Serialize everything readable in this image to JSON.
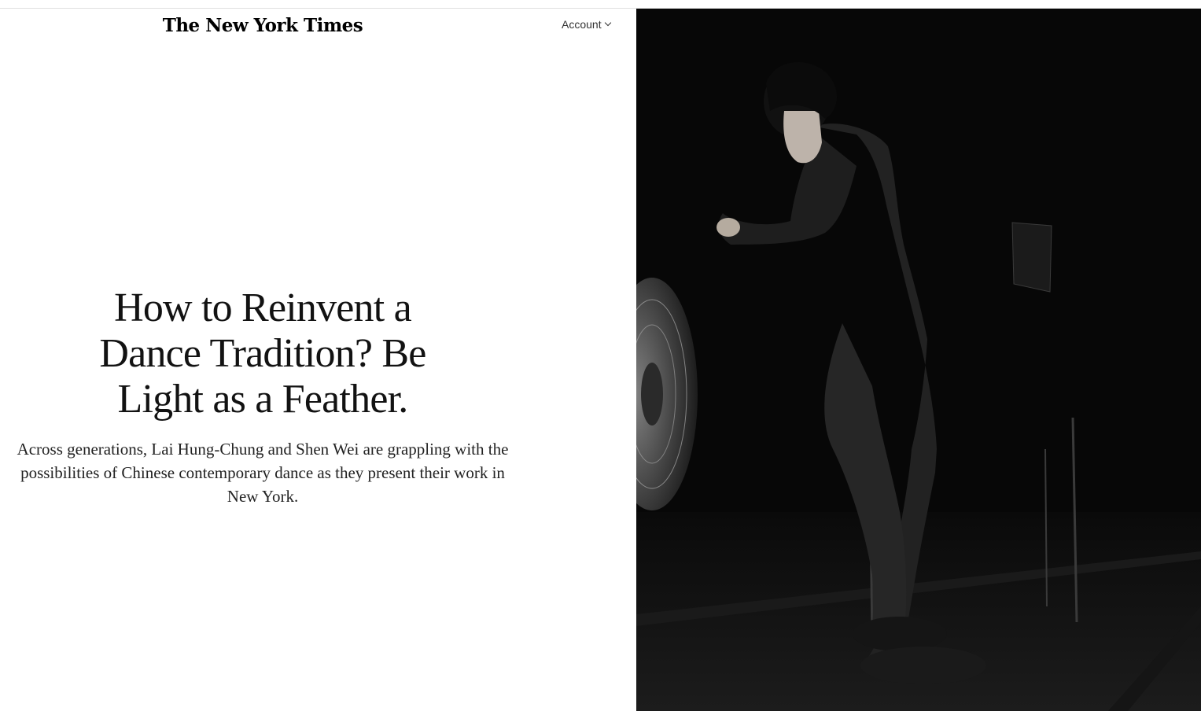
{
  "header": {
    "logo": "The New York Times",
    "account_label": "Account"
  },
  "article": {
    "headline": "How to Reinvent a Dance Tradition? Be Light as a Feather.",
    "summary": "Across generations, Lai Hung-Chung and Shen Wei are grappling with the possibilities of Chinese contemporary dance as they present their work in New York."
  },
  "media": {
    "type": "video",
    "subject": "dancer-in-black-suit"
  },
  "colors": {
    "text": "#121212",
    "background": "#ffffff",
    "media_bg": "#070707"
  }
}
